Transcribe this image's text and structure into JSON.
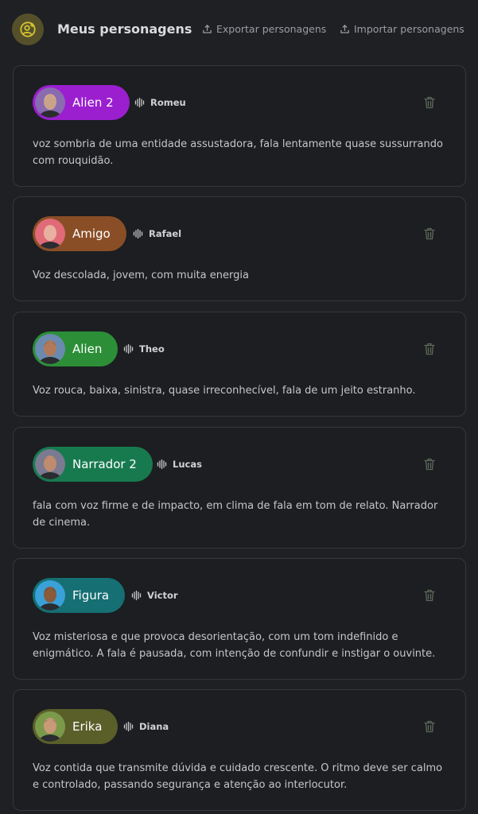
{
  "header": {
    "title": "Meus personagens",
    "export_label": "Exportar personagens",
    "import_label": "Importar personagens",
    "icon": "user-add-icon",
    "accent": "#c9b830"
  },
  "characters": [
    {
      "name": "Alien 2",
      "voice": "Romeu",
      "pill_color": "#9b1fcf",
      "description": "voz sombria de uma entidade assustadora, fala lentamente quase sussurrando com rouquidão."
    },
    {
      "name": "Amigo",
      "voice": "Rafael",
      "pill_color": "#8a4e26",
      "description": "Voz descolada, jovem, com muita energia"
    },
    {
      "name": "Alien",
      "voice": "Theo",
      "pill_color": "#2c8f38",
      "description": "Voz rouca, baixa, sinistra, quase irreconhecível, fala de um jeito estranho."
    },
    {
      "name": "Narrador 2",
      "voice": "Lucas",
      "pill_color": "#177a4f",
      "description": "fala com voz firme e de impacto, em clima de fala em tom de relato. Narrador de cinema."
    },
    {
      "name": "Figura",
      "voice": "Victor",
      "pill_color": "#156f73",
      "description": "Voz misteriosa e que provoca desorientação, com um tom indefinido e enigmático. A fala é pausada, com intenção de confundir e instigar o ouvinte."
    },
    {
      "name": "Erika",
      "voice": "Diana",
      "pill_color": "#5a5f2a",
      "description": "Voz contida que transmite dúvida e cuidado crescente. O ritmo deve ser calmo e controlado, passando segurança e atenção ao interlocutor."
    }
  ]
}
